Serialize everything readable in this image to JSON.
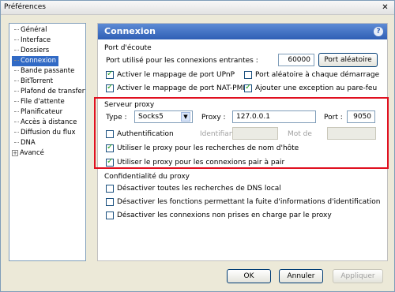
{
  "window": {
    "title": "Préférences",
    "close_glyph": "✕"
  },
  "sidebar": {
    "items": [
      {
        "label": "Général",
        "expandable": false
      },
      {
        "label": "Interface",
        "expandable": false
      },
      {
        "label": "Dossiers",
        "expandable": false
      },
      {
        "label": "Connexion",
        "expandable": false,
        "selected": true
      },
      {
        "label": "Bande passante",
        "expandable": false
      },
      {
        "label": "BitTorrent",
        "expandable": false
      },
      {
        "label": "Plafond de transfert",
        "expandable": false
      },
      {
        "label": "File d'attente",
        "expandable": false
      },
      {
        "label": "Planificateur",
        "expandable": false
      },
      {
        "label": "Accès à distance",
        "expandable": false
      },
      {
        "label": "Diffusion du flux",
        "expandable": false
      },
      {
        "label": "DNA",
        "expandable": false
      },
      {
        "label": "Avancé",
        "expandable": true
      }
    ],
    "expand_glyph": "+"
  },
  "content": {
    "title": "Connexion",
    "help_glyph": "?",
    "port": {
      "group_title": "Port d'écoute",
      "incoming_label": "Port utilisé pour les connexions entrantes :",
      "incoming_value": "60000",
      "random_button": "Port aléatoire",
      "upnp_label": "Activer le mappage de port UPnP",
      "upnp_checked": true,
      "random_start_label": "Port aléatoire à chaque démarrage",
      "random_start_checked": false,
      "natpmp_label": "Activer le mappage de port NAT-PMP",
      "natpmp_checked": true,
      "firewall_label": "Ajouter une exception au pare-feu",
      "firewall_checked": true
    },
    "proxy": {
      "group_title": "Serveur proxy",
      "type_label": "Type :",
      "type_value": "Socks5",
      "proxy_label": "Proxy :",
      "proxy_value": "127.0.0.1",
      "port_label": "Port :",
      "port_value": "9050",
      "auth_label": "Authentification",
      "auth_checked": false,
      "identifiant_label": "Identifiant :",
      "identifiant_value": "",
      "password_label": "Mot de",
      "password_value": "",
      "hostname_label": "Utiliser le proxy pour les recherches de nom d'hôte",
      "hostname_checked": true,
      "p2p_label": "Utiliser le proxy pour les connexions pair à pair",
      "p2p_checked": true
    },
    "privacy": {
      "group_title": "Confidentialité du proxy",
      "dns_label": "Désactiver toutes les recherches de DNS local",
      "dns_checked": false,
      "leak_label": "Désactiver les fonctions permettant la fuite d'informations d'identification",
      "leak_checked": false,
      "unsupported_label": "Désactiver les connexions non prises en charge par le proxy",
      "unsupported_checked": false
    }
  },
  "footer": {
    "ok": "OK",
    "cancel": "Annuler",
    "apply": "Appliquer"
  },
  "colors": {
    "accent": "#316ac5",
    "header": "#2f5fb5",
    "highlight_box": "#e01020"
  }
}
